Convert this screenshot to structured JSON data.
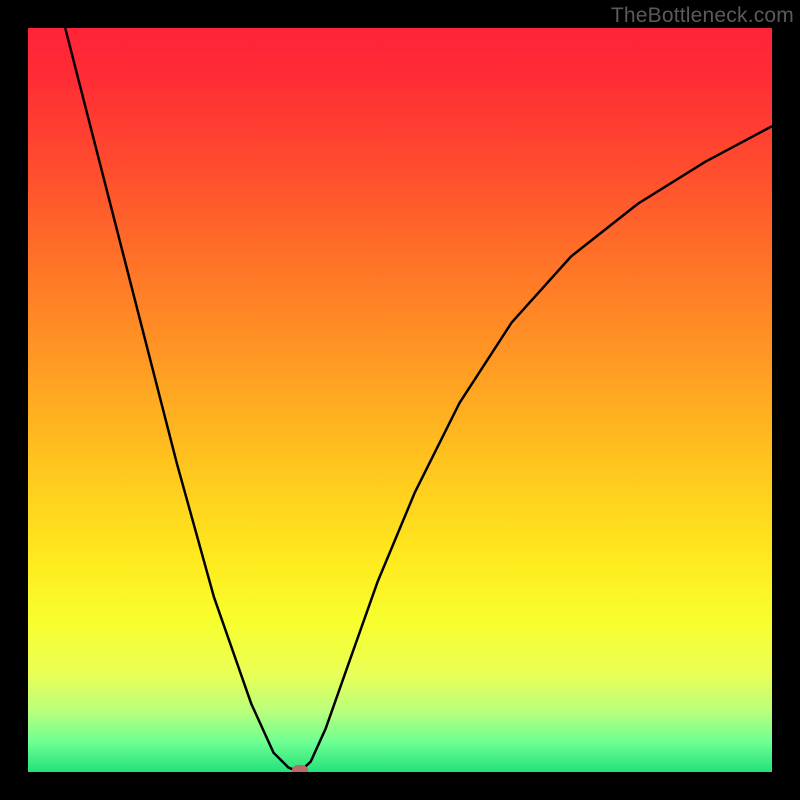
{
  "watermark": "TheBottleneck.com",
  "chart_data": {
    "type": "line",
    "title": "",
    "xlabel": "",
    "ylabel": "",
    "xlim": [
      0,
      100
    ],
    "ylim": [
      0,
      100
    ],
    "grid": false,
    "legend": false,
    "series": [
      {
        "name": "curve",
        "x": [
          5,
          10,
          15,
          20,
          25,
          30,
          33,
          35,
          36.5,
          38,
          40,
          43,
          47,
          52,
          58,
          65,
          73,
          82,
          91,
          100
        ],
        "values": [
          100,
          80.5,
          61,
          41.5,
          23.5,
          9.2,
          2.6,
          0.6,
          0,
          1.4,
          5.8,
          14.3,
          25.6,
          37.6,
          49.6,
          60.4,
          69.3,
          76.4,
          82,
          86.8
        ]
      }
    ],
    "marker": {
      "x": 36.5,
      "y": 0
    },
    "background": "rainbow-vertical"
  }
}
